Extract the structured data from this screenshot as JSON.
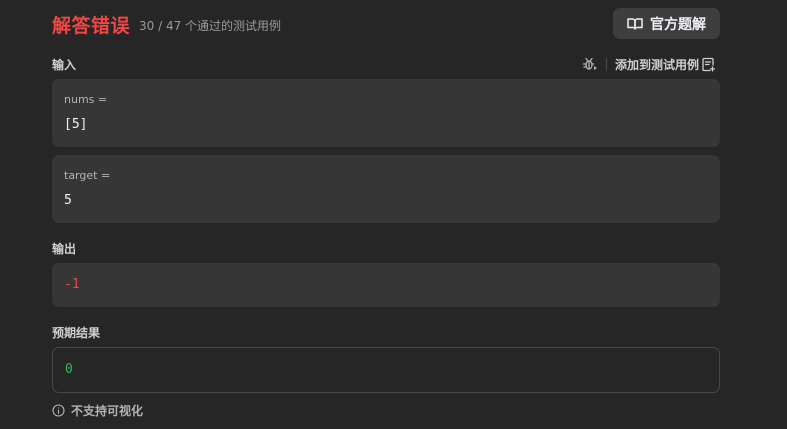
{
  "result": {
    "status": "解答错误",
    "pass_count": "30 / 47 个通过的测试用例",
    "status_color": "#ef4743"
  },
  "toolbar": {
    "solution_label": "官方题解",
    "solution_icon": "book-open-icon",
    "debug_icon": "bug-play-icon",
    "add_testcase_label": "添加到测试用例",
    "add_testcase_icon": "clipboard-add-icon"
  },
  "input": {
    "label": "输入",
    "params": [
      {
        "name": "nums =",
        "value": "[5]"
      },
      {
        "name": "target =",
        "value": "5"
      }
    ]
  },
  "output": {
    "label": "输出",
    "value": "-1",
    "color": "#ef4743"
  },
  "expected": {
    "label": "预期结果",
    "value": "0",
    "color": "#2cbb5d"
  },
  "footer": {
    "note": "不支持可视化",
    "icon": "info-icon"
  }
}
